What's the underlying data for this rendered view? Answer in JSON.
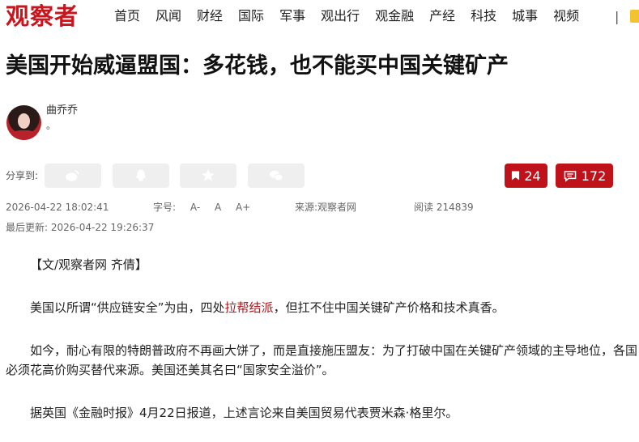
{
  "header": {
    "logo": "观察者",
    "nav": [
      "首页",
      "风闻",
      "财经",
      "国际",
      "军事",
      "观出行",
      "观金融",
      "产经",
      "科技",
      "城事",
      "视频"
    ],
    "separator": "|"
  },
  "article": {
    "title": "美国开始威逼盟国：多花钱，也不能买中国关键矿产",
    "author": {
      "name": "曲乔乔",
      "desc": "。"
    },
    "share": {
      "label": "分享到:",
      "buttons": [
        "weibo-icon",
        "qq-icon",
        "qzone-icon",
        "wechat-icon"
      ]
    },
    "stats": {
      "favorites": "24",
      "comments": "172"
    },
    "meta": {
      "published": "2026-04-22 18:02:41",
      "font_size_label": "字号:",
      "font_sizes": [
        "A-",
        "A",
        "A+"
      ],
      "source_label": "来源:",
      "source": "观察者网",
      "reads_label": "阅读",
      "reads": "214839",
      "updated_label": "最后更新:",
      "updated": "2026-04-22 19:26:37"
    },
    "paragraphs": {
      "p1": "【文/观察者网 齐倩】",
      "p2_pre": "美国以所谓“供应链安全”为由，四处",
      "p2_link": "拉帮结派",
      "p2_post": "，但扛不住中国关键矿产价格和技术真香。",
      "p3": "如今，耐心有限的特朗普政府不再画大饼了，而是直接施压盟友：为了打破中国在关键矿产领域的主导地位，各国必须花高价购买替代来源。美国还美其名曰“国家安全溢价”。",
      "p4": "据英国《金融时报》4月22日报道，上述言论来自美国贸易代表贾米森·格里尔。"
    }
  },
  "colors": {
    "brand": "#c8161e",
    "button_red": "#c0121b",
    "link": "#b0161d"
  }
}
